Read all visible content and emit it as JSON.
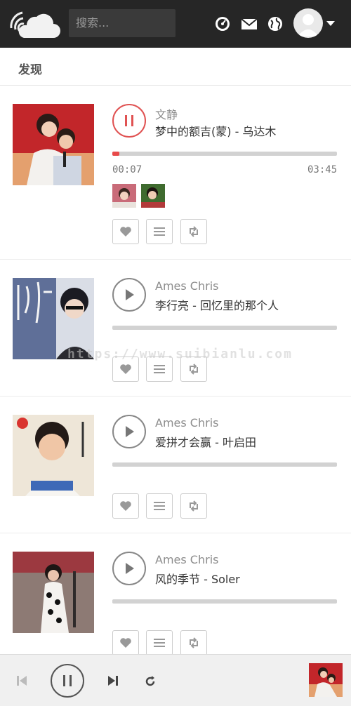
{
  "header": {
    "search_placeholder": "搜索...",
    "icons": [
      "dashboard-icon",
      "mail-icon",
      "globe-icon",
      "user-avatar-icon",
      "caret-down-icon"
    ]
  },
  "subheader": {
    "title": "发现"
  },
  "feed": [
    {
      "artist": "文静",
      "song": "梦中的额吉(蒙) - 乌达木",
      "state": "playing",
      "progress": 0.03,
      "current_time": "00:07",
      "duration": "03:45"
    },
    {
      "artist": "Ames Chris",
      "song": "李行亮 - 回忆里的那个人",
      "state": "paused",
      "progress": 0
    },
    {
      "artist": "Ames Chris",
      "song": "爱拼才会赢 - 叶启田",
      "state": "paused",
      "progress": 0
    },
    {
      "artist": "Ames Chris",
      "song": "风的季节 - Soler",
      "state": "paused",
      "progress": 0
    }
  ],
  "watermark": "https://www.suibianlu.com",
  "colors": {
    "accent": "#e05252",
    "topbar": "#262626",
    "player": "#f0f0f0"
  }
}
